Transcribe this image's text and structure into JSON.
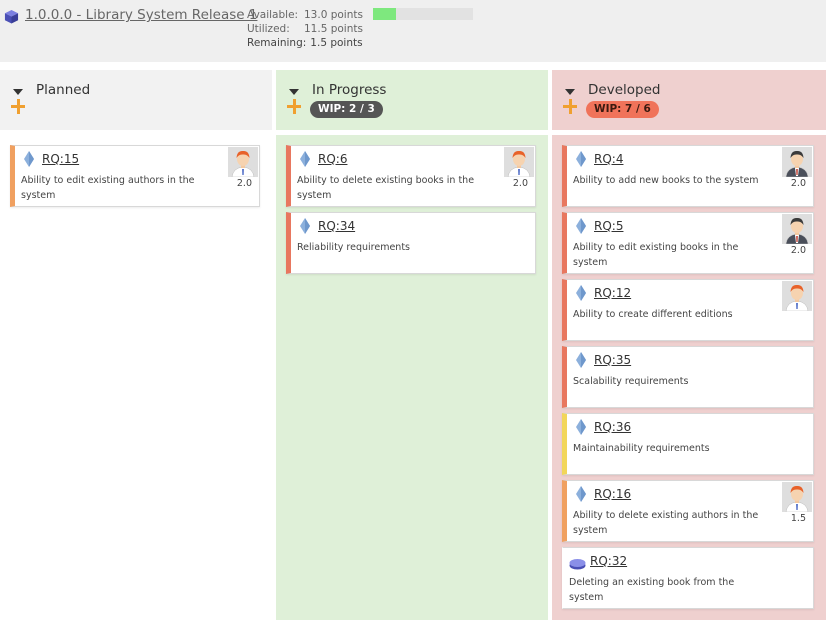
{
  "release": {
    "title": "1.0.0.0 - Library System Release 1",
    "available_label": "Available:",
    "available_value": "13.0 points",
    "utilized_label": "Utilized:",
    "utilized_value": "11.5 points",
    "remaining_label": "Remaining:",
    "remaining_value": "1.5 points",
    "progress_fraction": 0.23,
    "progress_color": "#7ee87e"
  },
  "columns": [
    {
      "title": "Planned",
      "wip": "",
      "header_color": "#f2f2f2",
      "body_color": "#ffffff",
      "cards": [
        {
          "id": "RQ:15",
          "desc": "Ability to edit existing authors in the system",
          "estimate": "2.0",
          "avatar": "orange-hair",
          "bar_color": "#f0a060",
          "icon": "diamond"
        }
      ]
    },
    {
      "title": "In Progress",
      "wip": "WIP: 2 / 3",
      "wip_bg": "#555555",
      "wip_fg": "#ffffff",
      "header_color": "#dff0d8",
      "body_color": "#dff0d8",
      "cards": [
        {
          "id": "RQ:6",
          "desc": "Ability to delete existing books in the system",
          "estimate": "2.0",
          "avatar": "orange-hair",
          "bar_color": "#e8775f",
          "icon": "diamond"
        },
        {
          "id": "RQ:34",
          "desc": "Reliability requirements",
          "estimate": "",
          "avatar": "",
          "bar_color": "#e8775f",
          "icon": "diamond"
        }
      ]
    },
    {
      "title": "Developed",
      "wip": "WIP: 7 / 6",
      "wip_bg": "#f0735a",
      "wip_fg": "#3a1a10",
      "header_color": "#efd0cf",
      "body_color": "#efd0cf",
      "cards": [
        {
          "id": "RQ:4",
          "desc": "Ability to add new books to the system",
          "estimate": "2.0",
          "avatar": "dark-hair",
          "bar_color": "#e8775f",
          "icon": "diamond"
        },
        {
          "id": "RQ:5",
          "desc": "Ability to edit existing books in the system",
          "estimate": "2.0",
          "avatar": "dark-hair",
          "bar_color": "#e8775f",
          "icon": "diamond"
        },
        {
          "id": "RQ:12",
          "desc": "Ability to create different editions",
          "estimate": "",
          "avatar": "orange-hair",
          "bar_color": "#e8775f",
          "icon": "diamond"
        },
        {
          "id": "RQ:35",
          "desc": "Scalability requirements",
          "estimate": "",
          "avatar": "",
          "bar_color": "#e8775f",
          "icon": "diamond"
        },
        {
          "id": "RQ:36",
          "desc": "Maintainability requirements",
          "estimate": "",
          "avatar": "",
          "bar_color": "#f2d65a",
          "icon": "diamond"
        },
        {
          "id": "RQ:16",
          "desc": "Ability to delete existing authors in the system",
          "estimate": "1.5",
          "avatar": "orange-hair",
          "bar_color": "#f0a060",
          "icon": "diamond"
        },
        {
          "id": "RQ:32",
          "desc": "Deleting an existing book from the system",
          "estimate": "",
          "avatar": "",
          "bar_color": "#ffffff",
          "icon": "disc"
        }
      ]
    }
  ]
}
